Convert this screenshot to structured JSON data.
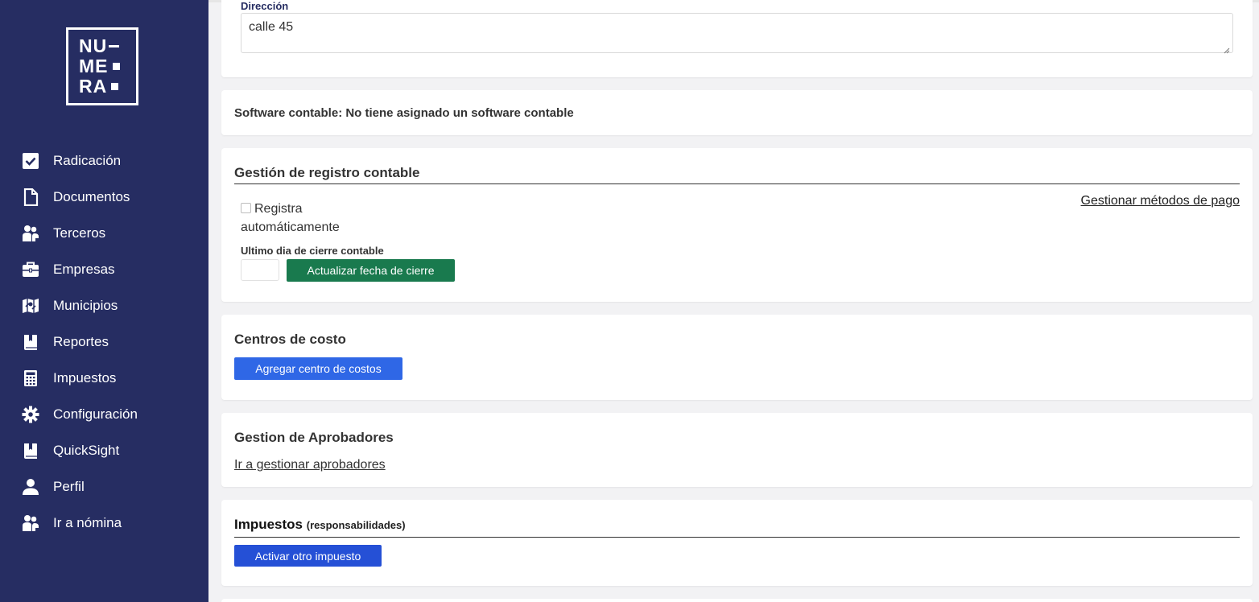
{
  "sidebar": {
    "logo": {
      "row1": "NU",
      "row2": "ME",
      "row3": "RA"
    },
    "items": [
      {
        "label": "Radicación",
        "icon": "checkbox-icon"
      },
      {
        "label": "Documentos",
        "icon": "file-icon"
      },
      {
        "label": "Terceros",
        "icon": "users-icon"
      },
      {
        "label": "Empresas",
        "icon": "briefcase-icon"
      },
      {
        "label": "Municipios",
        "icon": "map-icon"
      },
      {
        "label": "Reportes",
        "icon": "book-icon"
      },
      {
        "label": "Impuestos",
        "icon": "calculator-icon"
      },
      {
        "label": "Configuración",
        "icon": "gear-icon"
      },
      {
        "label": "QuickSight",
        "icon": "book-icon"
      },
      {
        "label": "Perfil",
        "icon": "user-icon"
      },
      {
        "label": "Ir a nómina",
        "icon": "users-icon"
      }
    ]
  },
  "direccion": {
    "label": "Dirección",
    "value": "calle 45"
  },
  "software": {
    "text": "Software contable: No tiene asignado un software contable"
  },
  "registro": {
    "title": "Gestión de registro contable",
    "checkbox_label_line1": "Registra",
    "checkbox_label_line2": "automáticamente",
    "checkbox_checked": false,
    "manage_link": "Gestionar métodos de pago",
    "cierre_label": "Ultimo dia de cierre contable",
    "cierre_value": "",
    "update_button": "Actualizar fecha de cierre"
  },
  "centros": {
    "title": "Centros de costo",
    "add_button": "Agregar centro de costos"
  },
  "aprobadores": {
    "title": "Gestion de Aprobadores",
    "link": "Ir a gestionar aprobadores"
  },
  "impuestos": {
    "title": "Impuestos",
    "note": "(responsabilidades)",
    "button": "Activar otro impuesto"
  },
  "colors": {
    "sidebar_bg": "#262d62",
    "green_button": "#197a4e",
    "blue_button": "#2f67e6"
  }
}
